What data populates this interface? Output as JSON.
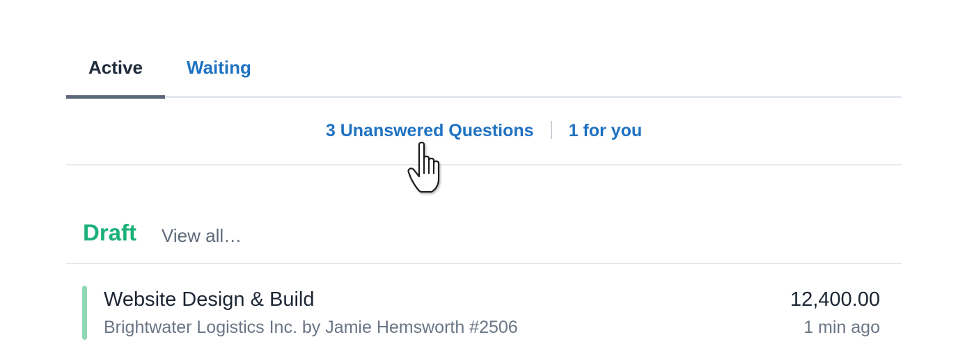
{
  "tabs": {
    "active_label": "Active",
    "waiting_label": "Waiting"
  },
  "questions": {
    "unanswered_label": "3 Unanswered Questions",
    "for_you_label": "1 for you"
  },
  "draft": {
    "title": "Draft",
    "view_all_label": "View all…",
    "items": [
      {
        "title": "Website Design & Build",
        "subtitle": "Brightwater Logistics Inc. by Jamie Hemsworth #2506",
        "amount": "12,400.00",
        "time": "1 min ago",
        "status_color": "#8fd8b4"
      }
    ]
  },
  "colors": {
    "link_blue": "#1f72c2",
    "draft_green": "#1ab07a",
    "text_dark": "#1c2533",
    "text_muted": "#6a7585"
  },
  "icons": {
    "cursor": "hand-pointer-cursor-icon"
  }
}
